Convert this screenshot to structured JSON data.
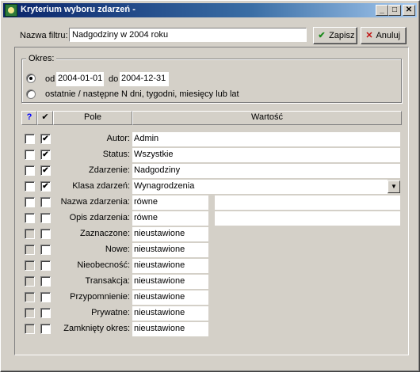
{
  "window": {
    "title": "Kryterium wyboru zdarzeń -"
  },
  "filter": {
    "name_label": "Nazwa filtru:",
    "name_value": "Nadgodziny w 2004 roku",
    "save_label": "Zapisz",
    "cancel_label": "Anuluj"
  },
  "period": {
    "legend": "Okres:",
    "from_label": "od",
    "from_value": "2004-01-01",
    "to_label": "do",
    "to_value": "2004-12-31",
    "relative_label": "ostatnie / następne N dni, tygodni, miesięcy lub lat",
    "selected": "range"
  },
  "table": {
    "col_help": "?",
    "col_check": "✔",
    "col_field": "Pole",
    "col_value": "Wartość"
  },
  "rows": [
    {
      "label": "Autor:",
      "value": "Admin",
      "cb1": false,
      "cb2": true,
      "enabled": true
    },
    {
      "label": "Status:",
      "value": "Wszystkie",
      "cb1": false,
      "cb2": true,
      "enabled": true
    },
    {
      "label": "Zdarzenie:",
      "value": "Nadgodziny",
      "cb1": false,
      "cb2": true,
      "enabled": true
    },
    {
      "label": "Klasa zdarzeń:",
      "value": "Wynagrodzenia",
      "cb1": false,
      "cb2": true,
      "enabled": true
    },
    {
      "label": "Nazwa zdarzenia:",
      "value": "równe",
      "extra": "",
      "cb1": false,
      "cb2": false,
      "enabled": true
    },
    {
      "label": "Opis zdarzenia:",
      "value": "równe",
      "extra": "",
      "cb1": false,
      "cb2": false,
      "enabled": true
    },
    {
      "label": "Zaznaczone:",
      "value": "nieustawione",
      "cb1": false,
      "cb2": false,
      "enabled": false
    },
    {
      "label": "Nowe:",
      "value": "nieustawione",
      "cb1": false,
      "cb2": false,
      "enabled": false
    },
    {
      "label": "Nieobecność:",
      "value": "nieustawione",
      "cb1": false,
      "cb2": false,
      "enabled": false
    },
    {
      "label": "Transakcja:",
      "value": "nieustawione",
      "cb1": false,
      "cb2": false,
      "enabled": false
    },
    {
      "label": "Przypomnienie:",
      "value": "nieustawione",
      "cb1": false,
      "cb2": false,
      "enabled": false
    },
    {
      "label": "Prywatne:",
      "value": "nieustawione",
      "cb1": false,
      "cb2": false,
      "enabled": false
    },
    {
      "label": "Zamknięty okres:",
      "value": "nieustawione",
      "cb1": false,
      "cb2": false,
      "enabled": false
    }
  ]
}
